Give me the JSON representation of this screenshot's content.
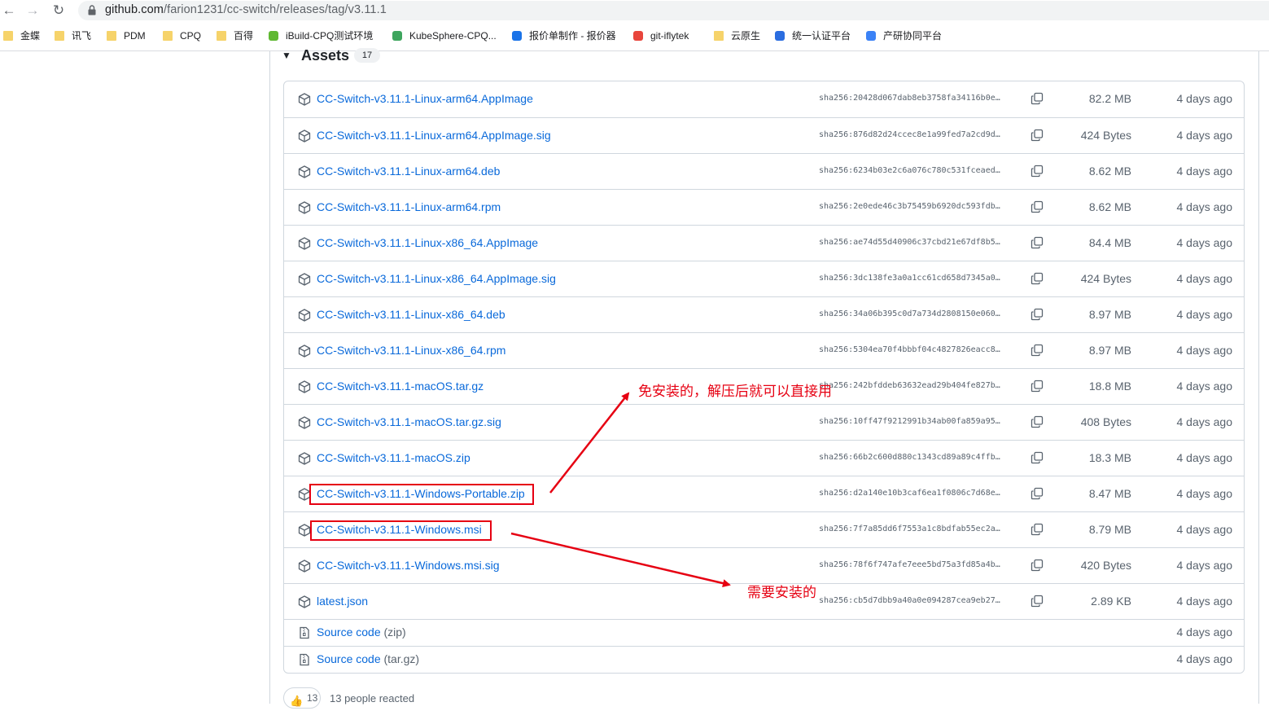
{
  "browser": {
    "url_host": "github.com",
    "url_path": "/farion1231/cc-switch/releases/tag/v3.11.1"
  },
  "bookmarks": [
    {
      "label": "金蝶",
      "icon": "folder-icon"
    },
    {
      "label": "讯飞",
      "icon": "folder-icon"
    },
    {
      "label": "PDM",
      "icon": "folder-icon"
    },
    {
      "label": "CPQ",
      "icon": "folder-icon"
    },
    {
      "label": "百得",
      "icon": "folder-icon"
    },
    {
      "label": "iBuild-CPQ测试环境",
      "icon": "ibuild-icon"
    },
    {
      "label": "KubeSphere-CPQ...",
      "icon": "kubesphere-icon"
    },
    {
      "label": "报价单制作 - 报价器",
      "icon": "quote-icon"
    },
    {
      "label": "git-iflytek",
      "icon": "gitlab-icon"
    },
    {
      "label": "云原生",
      "icon": "folder-icon"
    },
    {
      "label": "统一认证平台",
      "icon": "auth-icon"
    },
    {
      "label": "产研协同平台",
      "icon": "collab-icon"
    }
  ],
  "assets": {
    "title": "Assets",
    "count": "17",
    "rows": [
      {
        "name": "CC-Switch-v3.11.1-Linux-arm64.AppImage",
        "sha": "sha256:20428d067dab8eb3758fa34116b0e…",
        "size": "82.2 MB",
        "date": "4 days ago"
      },
      {
        "name": "CC-Switch-v3.11.1-Linux-arm64.AppImage.sig",
        "sha": "sha256:876d82d24ccec8e1a99fed7a2cd9d…",
        "size": "424 Bytes",
        "date": "4 days ago"
      },
      {
        "name": "CC-Switch-v3.11.1-Linux-arm64.deb",
        "sha": "sha256:6234b03e2c6a076c780c531fceaed…",
        "size": "8.62 MB",
        "date": "4 days ago"
      },
      {
        "name": "CC-Switch-v3.11.1-Linux-arm64.rpm",
        "sha": "sha256:2e0ede46c3b75459b6920dc593fdb…",
        "size": "8.62 MB",
        "date": "4 days ago"
      },
      {
        "name": "CC-Switch-v3.11.1-Linux-x86_64.AppImage",
        "sha": "sha256:ae74d55d40906c37cbd21e67df8b5…",
        "size": "84.4 MB",
        "date": "4 days ago"
      },
      {
        "name": "CC-Switch-v3.11.1-Linux-x86_64.AppImage.sig",
        "sha": "sha256:3dc138fe3a0a1cc61cd658d7345a0…",
        "size": "424 Bytes",
        "date": "4 days ago"
      },
      {
        "name": "CC-Switch-v3.11.1-Linux-x86_64.deb",
        "sha": "sha256:34a06b395c0d7a734d2808150e060…",
        "size": "8.97 MB",
        "date": "4 days ago"
      },
      {
        "name": "CC-Switch-v3.11.1-Linux-x86_64.rpm",
        "sha": "sha256:5304ea70f4bbbf04c4827826eacc8…",
        "size": "8.97 MB",
        "date": "4 days ago"
      },
      {
        "name": "CC-Switch-v3.11.1-macOS.tar.gz",
        "sha": "sha256:242bfddeb63632ead29b404fe827b…",
        "size": "18.8 MB",
        "date": "4 days ago"
      },
      {
        "name": "CC-Switch-v3.11.1-macOS.tar.gz.sig",
        "sha": "sha256:10ff47f9212991b34ab00fa859a95…",
        "size": "408 Bytes",
        "date": "4 days ago"
      },
      {
        "name": "CC-Switch-v3.11.1-macOS.zip",
        "sha": "sha256:66b2c600d880c1343cd89a89c4ffb…",
        "size": "18.3 MB",
        "date": "4 days ago"
      },
      {
        "name": "CC-Switch-v3.11.1-Windows-Portable.zip",
        "sha": "sha256:d2a140e10b3caf6ea1f0806c7d68e…",
        "size": "8.47 MB",
        "date": "4 days ago"
      },
      {
        "name": "CC-Switch-v3.11.1-Windows.msi",
        "sha": "sha256:7f7a85dd6f7553a1c8bdfab55ec2a…",
        "size": "8.79 MB",
        "date": "4 days ago"
      },
      {
        "name": "CC-Switch-v3.11.1-Windows.msi.sig",
        "sha": "sha256:78f6f747afe7eee5bd75a3fd85a4b…",
        "size": "420 Bytes",
        "date": "4 days ago"
      },
      {
        "name": "latest.json",
        "sha": "sha256:cb5d7dbb9a40a0e094287cea9eb27…",
        "size": "2.89 KB",
        "date": "4 days ago"
      }
    ],
    "source_rows": [
      {
        "label": "Source code",
        "ext": "(zip)",
        "date": "4 days ago"
      },
      {
        "label": "Source code",
        "ext": "(tar.gz)",
        "date": "4 days ago"
      }
    ]
  },
  "annotations": {
    "portable": "免安装的，解压后就可以直接用",
    "installer": "需要安装的",
    "color": "#e60012"
  },
  "reactions": {
    "emoji": "👍",
    "count": "13",
    "text": "13 people reacted"
  },
  "colors": {
    "link": "#0969da",
    "muted": "#59636e",
    "border": "#d0d7de"
  }
}
